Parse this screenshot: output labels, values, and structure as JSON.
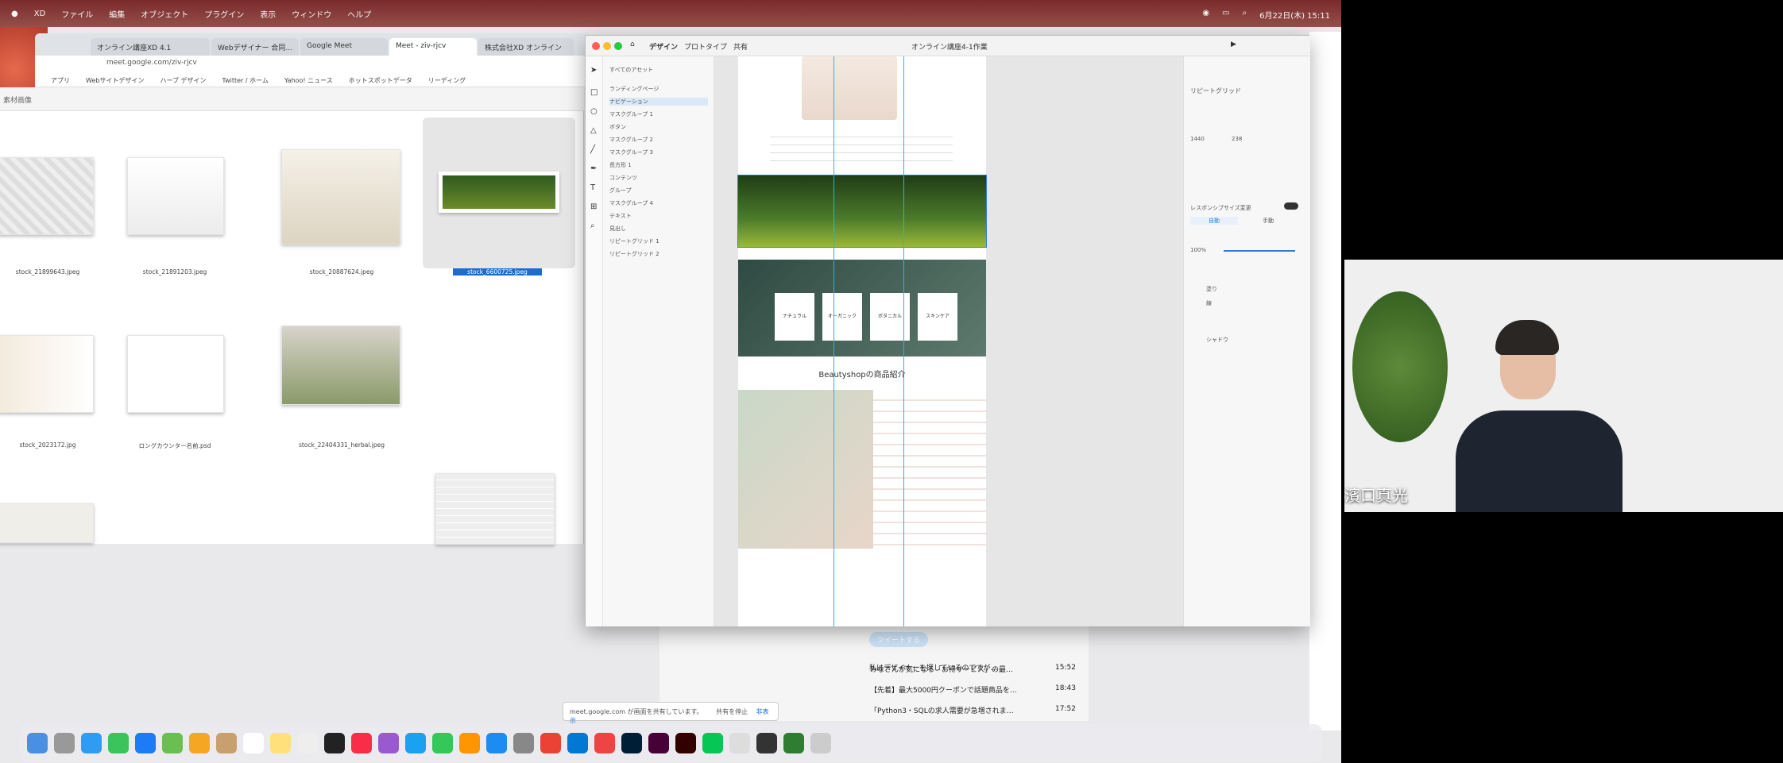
{
  "menubar": {
    "items": [
      "XD",
      "ファイル",
      "編集",
      "オブジェクト",
      "プラグイン",
      "表示",
      "ウィンドウ",
      "ヘルプ"
    ],
    "clock": "6月22日(木) 15:11"
  },
  "browser": {
    "tabs": [
      "オンライン講座XD 4.1",
      "Webデザイナー 合同…",
      "Google Meet",
      "Meet - ziv-rjcv",
      "株式会社XD オンライン"
    ],
    "url": "meet.google.com/ziv-rjcv",
    "bookmarks": [
      "アプリ",
      "Webサイトデザイン",
      "ハーブ デザイン",
      "Twitter / ホーム",
      "Yahoo! ニュース",
      "ホットスポットデータ",
      "リーディング"
    ]
  },
  "finder": {
    "toolbar": "素材画像",
    "files": [
      "stock_21899643.jpeg",
      "stock_21891203.jpeg",
      "stock_20887624.jpeg",
      "stock_6600725.jpeg",
      "stock_2023172.jpg",
      "ロングカウンター名前.psd",
      "stock_22404331_herbal.jpeg"
    ]
  },
  "xd": {
    "tabs": [
      "デザイン",
      "プロトタイプ",
      "共有"
    ],
    "doc_title": "オンライン講座4-1作業",
    "layers_search": "すべてのアセット",
    "layers": [
      "ランディングページ",
      "ナビゲーション",
      "マスクグループ 1",
      "ボタン",
      "マスクグループ 2",
      "マスクグループ 3",
      "長方形 1",
      "コンテンツ",
      "グループ",
      "マスクグループ 4",
      "テキスト",
      "見出し",
      "リピートグリッド 1",
      "リピートグリッド 2"
    ],
    "props": {
      "section1": "リピートグリッド",
      "w": "1440",
      "h": "238",
      "responsive": "レスポンシブサイズ変更",
      "opacity": "100%",
      "fill": "塗り",
      "border": "線",
      "shadow": "シャドウ",
      "toggle_tab1": "自動",
      "toggle_tab2": "手動"
    },
    "artboard": {
      "section_title": "Beautyshopの商品紹介",
      "cards": [
        "ナチュラル",
        "オーガニック",
        "ボタニカル",
        "スキンケア"
      ]
    }
  },
  "video": {
    "speaker_name": "濱口真光"
  },
  "news": {
    "tweet_button": "ツイートする",
    "items": [
      {
        "text": "みなさんが気になる「お得サービス」の最…",
        "time": "15:52"
      },
      {
        "text": "【先着】最大5000円クーポンで話題商品を…",
        "time": "18:43"
      },
      {
        "text": "「Python3・SQLの求人需要が急増されま…",
        "time": "17:52"
      }
    ],
    "side_tweet": "私はデザイナーを探しているのですが…"
  },
  "notification": {
    "text": "meet.google.com が画面を共有しています。",
    "stop": "共有を停止",
    "hide": "非表示"
  }
}
